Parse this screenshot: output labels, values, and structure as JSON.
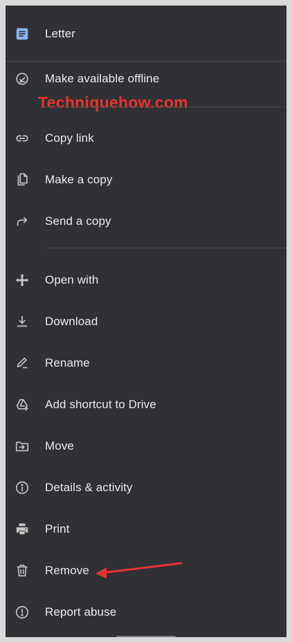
{
  "menu": {
    "header": {
      "title": "Letter",
      "icon": "docs-file-icon",
      "icon_color": "#8ab4f8"
    },
    "items": [
      {
        "label": "Make available offline",
        "icon": "offline-check-icon"
      },
      {
        "label": "Copy link",
        "icon": "link-icon"
      },
      {
        "label": "Make a copy",
        "icon": "copy-icon"
      },
      {
        "label": "Send a copy",
        "icon": "share-arrow-icon"
      },
      {
        "label": "Open with",
        "icon": "open-with-icon"
      },
      {
        "label": "Download",
        "icon": "download-icon"
      },
      {
        "label": "Rename",
        "icon": "rename-icon"
      },
      {
        "label": "Add shortcut to Drive",
        "icon": "add-shortcut-icon"
      },
      {
        "label": "Move",
        "icon": "move-folder-icon"
      },
      {
        "label": "Details & activity",
        "icon": "info-icon"
      },
      {
        "label": "Print",
        "icon": "print-icon"
      },
      {
        "label": "Remove",
        "icon": "trash-icon"
      },
      {
        "label": "Report abuse",
        "icon": "report-icon"
      }
    ]
  },
  "watermark": {
    "text": "Techniquehow.com",
    "color": "#e8332f"
  },
  "annotation": {
    "color": "#e8332f"
  },
  "theme": {
    "background": "#303134",
    "text": "#e8eaed",
    "icon": "#c4c7c5"
  }
}
